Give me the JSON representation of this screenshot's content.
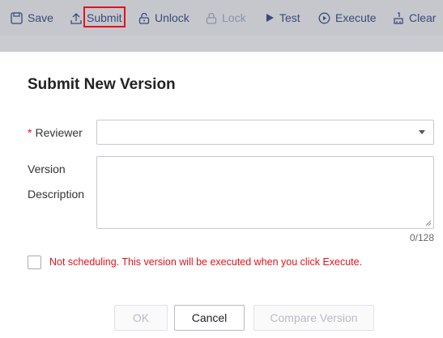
{
  "toolbar": {
    "items": [
      {
        "label": "Save",
        "icon": "save-icon",
        "enabled": true
      },
      {
        "label": "Submit",
        "icon": "upload-icon",
        "enabled": true,
        "highlighted": true
      },
      {
        "label": "Unlock",
        "icon": "unlock-icon",
        "enabled": true
      },
      {
        "label": "Lock",
        "icon": "lock-icon",
        "enabled": false
      },
      {
        "label": "Test",
        "icon": "play-icon",
        "enabled": true
      },
      {
        "label": "Execute",
        "icon": "play-circle-icon",
        "enabled": true
      },
      {
        "label": "Clear",
        "icon": "broom-icon",
        "enabled": true
      }
    ],
    "highlight_color": "#e0141e"
  },
  "dialog": {
    "title": "Submit New Version",
    "reviewer": {
      "required_mark": "*",
      "label": "Reviewer",
      "value": ""
    },
    "description": {
      "label_line1": "Version",
      "label_line2": "Description",
      "value": "",
      "counter": "0/128"
    },
    "schedule_checkbox": {
      "checked": false,
      "label": "Not scheduling. This version will be executed when you click Execute."
    },
    "buttons": {
      "ok": "OK",
      "cancel": "Cancel",
      "compare": "Compare Version"
    }
  }
}
